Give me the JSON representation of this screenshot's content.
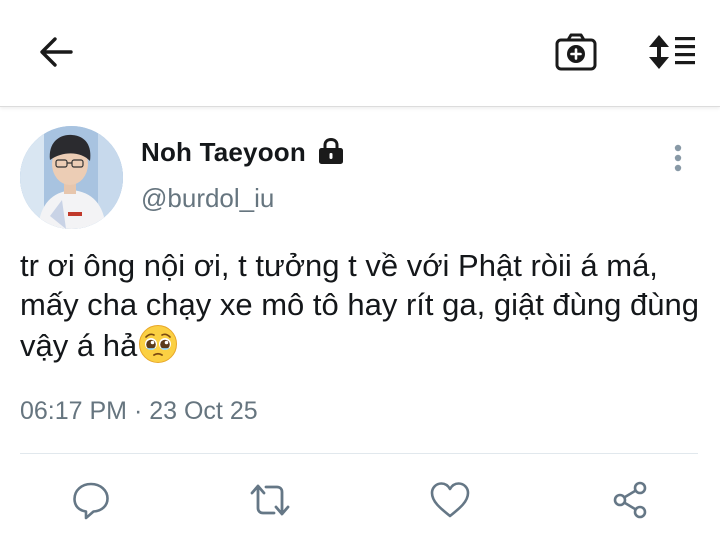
{
  "header": {
    "back_icon": "arrow-left-icon",
    "camera_icon": "camera-add-icon",
    "sort_icon": "sort-list-icon"
  },
  "tweet": {
    "display_name": "Noh Taeyoon",
    "handle": "@burdol_iu",
    "protected_icon": "lock-icon",
    "text": "tr ơi ông nội ơi, t tưởng t về với Phật ròii á má, mấy cha chạy xe mô tô hay rít ga, giật đùng đùng vậy á hả",
    "emoji": "🥹",
    "timestamp": "06:17 PM · 23 Oct 25"
  },
  "actions": [
    "reply-icon",
    "retweet-icon",
    "like-icon",
    "share-icon"
  ],
  "colors": {
    "text": "#14171a",
    "secondary": "#66757f",
    "icon": "#657786",
    "divider": "#e1e8ed"
  }
}
